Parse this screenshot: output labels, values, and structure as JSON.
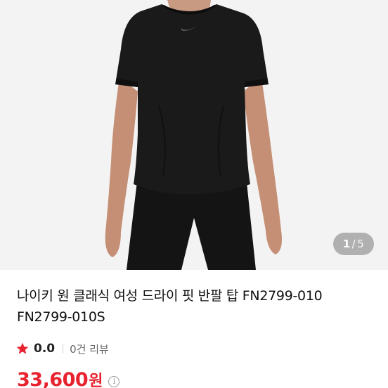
{
  "gallery": {
    "current_index": "1",
    "separator": "/",
    "total": "5",
    "image_alt": "black short sleeve top and black leggings"
  },
  "product": {
    "title_line1": "나이키 원 클래식 여성 드라이 핏 반팔 탑 FN2799-010",
    "title_line2": "FN2799-010S",
    "rating": "0.0",
    "review_count_label": "0건 리뷰",
    "price_amount": "33,600",
    "price_unit": "원"
  },
  "colors": {
    "price": "#e8222e",
    "star": "#e8222e",
    "image_bg": "#f3f3f3"
  },
  "icons": {
    "rating": "star-icon",
    "price_info": "info-icon"
  }
}
